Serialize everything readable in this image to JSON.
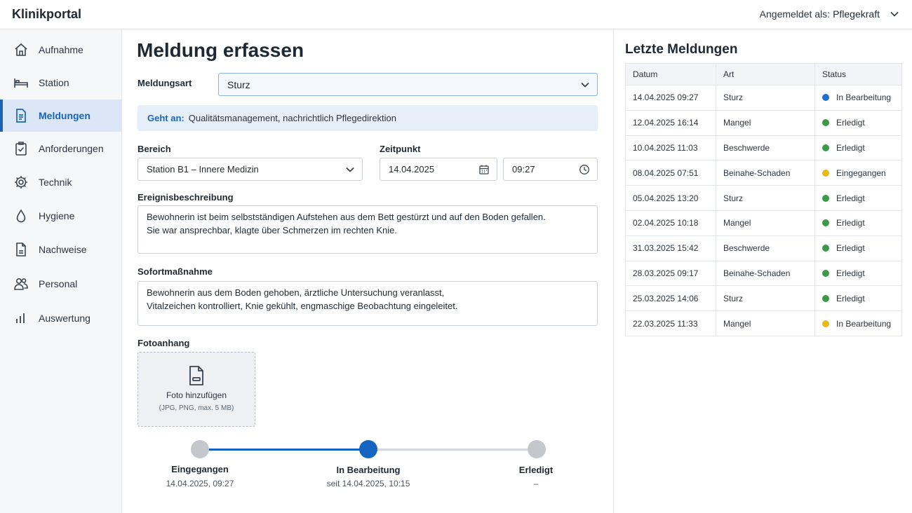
{
  "app": {
    "title": "Klinikportal"
  },
  "user": {
    "prefix": "Angemeldet als:",
    "role": "Pflegekraft"
  },
  "sidebar": {
    "items": [
      {
        "label": "Aufnahme",
        "icon": "home-icon"
      },
      {
        "label": "Station",
        "icon": "bed-icon"
      },
      {
        "label": "Meldungen",
        "icon": "document-icon",
        "active": true
      },
      {
        "label": "Anforderungen",
        "icon": "clipboard-check-icon"
      },
      {
        "label": "Technik",
        "icon": "gear-icon"
      },
      {
        "label": "Hygiene",
        "icon": "droplet-icon"
      },
      {
        "label": "Nachweise",
        "icon": "file-icon"
      },
      {
        "label": "Personal",
        "icon": "people-icon"
      },
      {
        "label": "Auswertung",
        "icon": "bar-chart-icon"
      }
    ]
  },
  "form": {
    "title": "Meldung erfassen",
    "meldungsart": {
      "label": "Meldungsart",
      "value": "Sturz"
    },
    "info": {
      "key": "Geht an:",
      "value": "Qualitätsmanagement, nachrichtlich Pflegedirektion"
    },
    "bereich": {
      "label": "Bereich",
      "value": "Station B1 – Innere Medizin"
    },
    "zeitpunkt": {
      "label": "Zeitpunkt",
      "date": "14.04.2025",
      "time": "09:27"
    },
    "beschreibung": {
      "label": "Ereignisbeschreibung",
      "value": "Bewohnerin ist beim selbstständigen Aufstehen aus dem Bett gestürzt und auf den Boden gefallen.\nSie war ansprechbar, klagte über Schmerzen im rechten Knie."
    },
    "sofort": {
      "label": "Sofortmaßnahme",
      "value": "Bewohnerin aus dem Boden gehoben, ärztliche Untersuchung veranlasst,\nVitalzeichen kontrolliert, Knie gekühlt, engmaschige Beobachtung eingeleitet."
    },
    "foto": {
      "label": "Fotoanhang",
      "button": "Foto hinzufügen",
      "hint": "(JPG, PNG, max. 5 MB)"
    }
  },
  "timeline": {
    "steps": [
      {
        "label": "Eingegangen",
        "sub": "14.04.2025, 09:27"
      },
      {
        "label": "In Bearbeitung",
        "sub": "seit 14.04.2025, 10:15"
      },
      {
        "label": "Erledigt",
        "sub": "–"
      }
    ],
    "current_step": 2
  },
  "reports": {
    "title": "Letzte Meldungen",
    "columns": [
      "Datum",
      "Art",
      "Status"
    ],
    "rows": [
      {
        "date": "14.04.2025 09:27",
        "type": "Sturz",
        "status": "In Bearbeitung",
        "color": "#1f6fd1"
      },
      {
        "date": "12.04.2025 16:14",
        "type": "Mangel",
        "status": "Erledigt",
        "color": "#3a9a45"
      },
      {
        "date": "10.04.2025 11:03",
        "type": "Beschwerde",
        "status": "Erledigt",
        "color": "#3a9a45"
      },
      {
        "date": "08.04.2025 07:51",
        "type": "Beinahe-Schaden",
        "status": "Eingegangen",
        "color": "#e8b915"
      },
      {
        "date": "05.04.2025 13:20",
        "type": "Sturz",
        "status": "Erledigt",
        "color": "#3a9a45"
      },
      {
        "date": "02.04.2025 10:18",
        "type": "Mangel",
        "status": "Erledigt",
        "color": "#3a9a45"
      },
      {
        "date": "31.03.2025 15:42",
        "type": "Beschwerde",
        "status": "Erledigt",
        "color": "#3a9a45"
      },
      {
        "date": "28.03.2025 09:17",
        "type": "Beinahe-Schaden",
        "status": "Erledigt",
        "color": "#3a9a45"
      },
      {
        "date": "25.03.2025 14:06",
        "type": "Sturz",
        "status": "Erledigt",
        "color": "#3a9a45"
      },
      {
        "date": "22.03.2025 11:33",
        "type": "Mangel",
        "status": "In Bearbeitung",
        "color": "#e8b915"
      }
    ]
  },
  "colors": {
    "accent": "#1a64b8",
    "timeline_active": "#1565c0",
    "timeline_inactive": "#c4c8cd"
  }
}
